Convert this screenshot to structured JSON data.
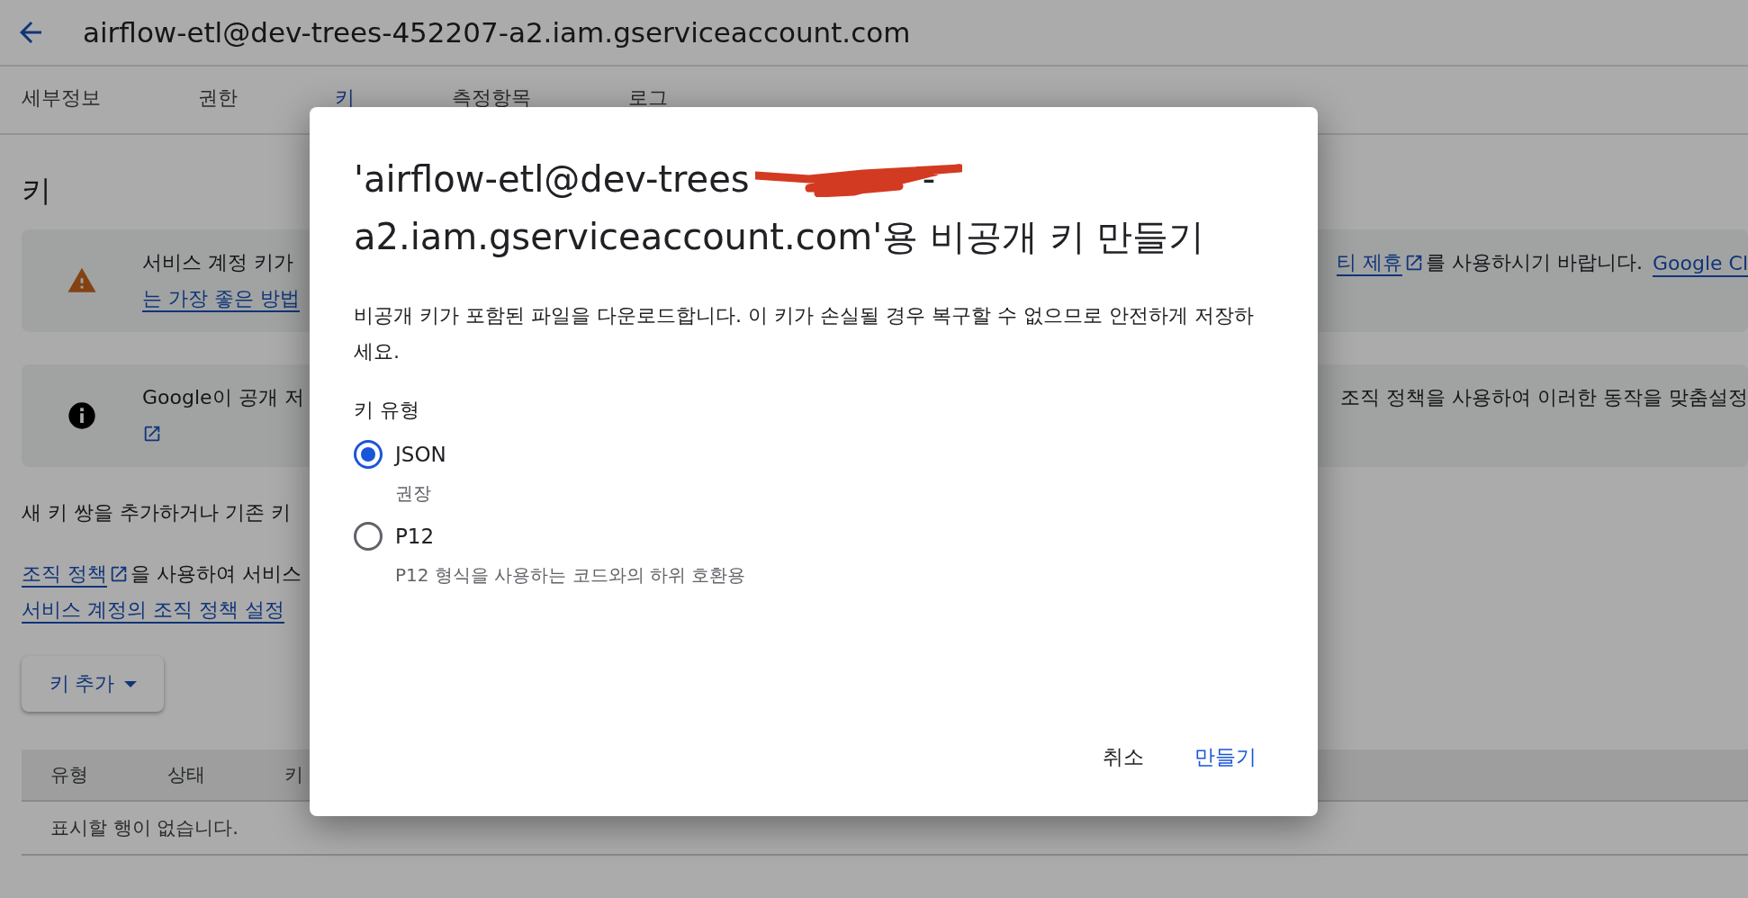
{
  "header": {
    "title": "airflow-etl@dev-trees-452207-a2.iam.gserviceaccount.com"
  },
  "tabs": [
    {
      "label": "세부정보",
      "selected": false
    },
    {
      "label": "권한",
      "selected": false
    },
    {
      "label": "키",
      "selected": true
    },
    {
      "label": "측정항목",
      "selected": false
    },
    {
      "label": "로그",
      "selected": false
    }
  ],
  "heading": "키",
  "warning_card": {
    "line1_left": "서비스 계정 키가",
    "line1_right_link": "티 제휴",
    "line1_right_text": "를 사용하시기 바랍니다.",
    "line1_right_link2": "Google Cl",
    "line2_left_link": "는 가장 좋은 방법"
  },
  "info_card": {
    "line1_left": "Google이 공개 저",
    "line1_right": "조직 정책을 사용하여 이러한 동작을 맞춤설정"
  },
  "intro": "새 키 쌍을 추가하거나 기존 키",
  "policy_link": "조직 정책",
  "policy_text": "을 사용하여 서비스",
  "policy_link2": "서비스 계정의 조직 정책 설정",
  "add_key_button": "키 추가",
  "table": {
    "columns": [
      "유형",
      "상태",
      "키"
    ],
    "empty": "표시할 행이 없습니다."
  },
  "dialog": {
    "title_part1": "'airflow-etl@dev-trees",
    "title_part2": "-",
    "title_line2": "a2.iam.gserviceaccount.com'용 비공개 키 만들기",
    "description": "비공개 키가 포함된 파일을 다운로드합니다. 이 키가 손실될 경우 복구할 수 없으므로 안전하게 저장하세요.",
    "key_type_label": "키 유형",
    "options": [
      {
        "label": "JSON",
        "hint": "권장",
        "selected": true
      },
      {
        "label": "P12",
        "hint": "P12 형식을 사용하는 코드와의 하위 호환용",
        "selected": false
      }
    ],
    "cancel": "취소",
    "create": "만들기"
  }
}
